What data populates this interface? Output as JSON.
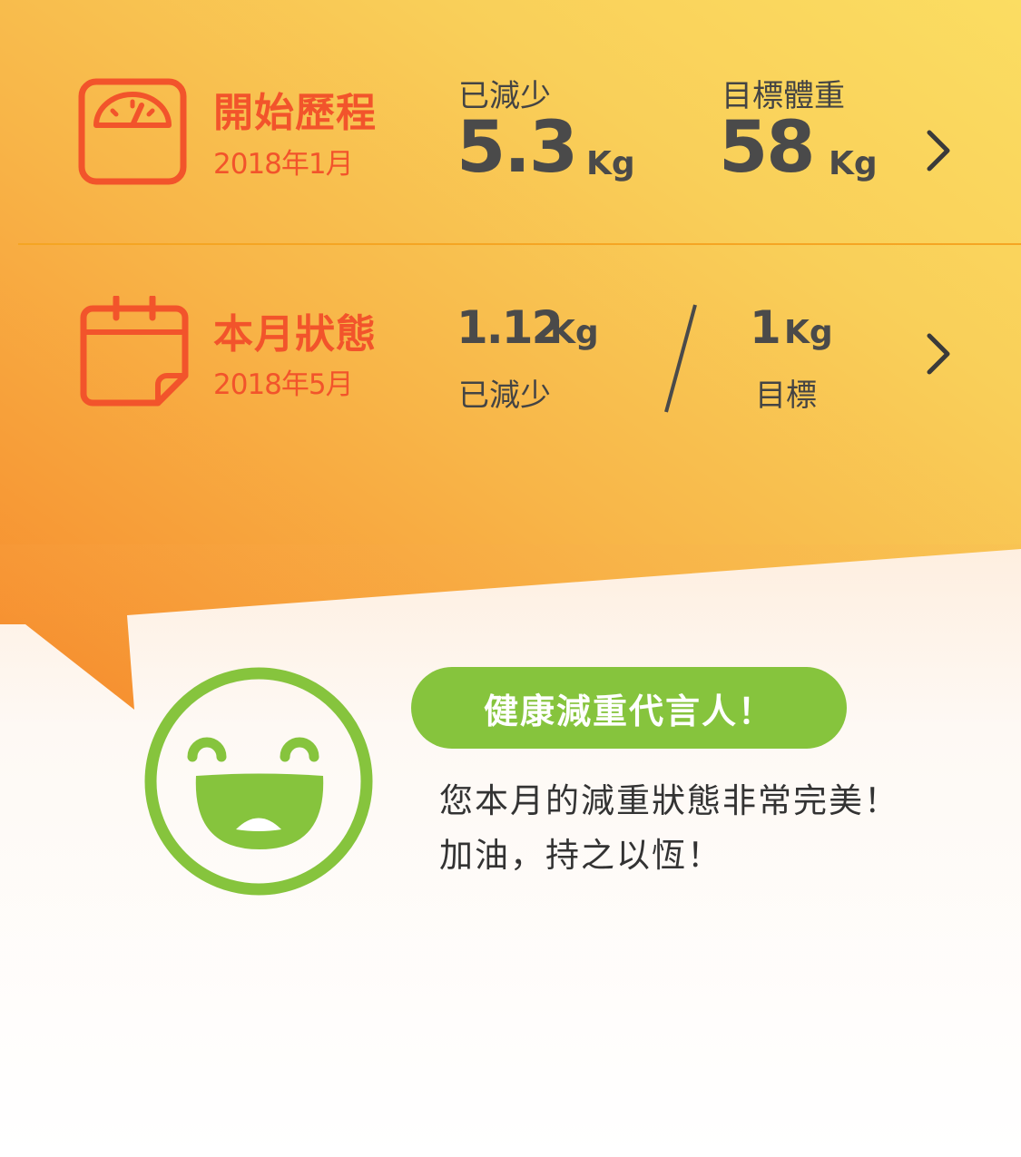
{
  "journey": {
    "title": "開始歷程",
    "date": "2018年1月",
    "lost_label": "已減少",
    "lost_value": "5.3",
    "lost_unit": "Kg",
    "target_label": "目標體重",
    "target_value": "58",
    "target_unit": "Kg",
    "icon": "scale-icon"
  },
  "month": {
    "title": "本月狀態",
    "date": "2018年5月",
    "lost_value": "1.12",
    "lost_unit": "Kg",
    "lost_label": "已減少",
    "goal_value": "1",
    "goal_unit": "Kg",
    "goal_label": "目標",
    "icon": "calendar-icon"
  },
  "feedback": {
    "badge": "健康減重代言人！",
    "line1": "您本月的減重狀態非常完美！",
    "line2": "加油，持之以恆！",
    "icon": "smiley-icon"
  },
  "colors": {
    "accent": "#f2542b",
    "green": "#86c43d",
    "divider": "#f5a523",
    "text": "#4a4a4a"
  }
}
